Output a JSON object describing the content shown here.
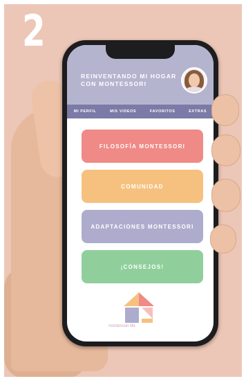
{
  "step_number": "2",
  "app": {
    "title": "REINVENTANDO MI HOGAR CON MONTESSORI",
    "nav": [
      "MI PERFIL",
      "MIS VIDEOS",
      "FAVORITOS",
      "EXTRAS"
    ],
    "buttons": [
      {
        "label": "FILOSOFÍA MONTESSORI",
        "color": "#ef8a87"
      },
      {
        "label": "COMUNIDAD",
        "color": "#f6c17f"
      },
      {
        "label": "ADAPTACIONES MONTESSORI",
        "color": "#aeaccd"
      },
      {
        "label": "¡CONSEJOS!",
        "color": "#90cf9c"
      }
    ],
    "logo_text": "montessori life"
  },
  "colors": {
    "background": "#ecc6b6",
    "header": "#b5b4cf",
    "nav": "#7c7aa6"
  }
}
